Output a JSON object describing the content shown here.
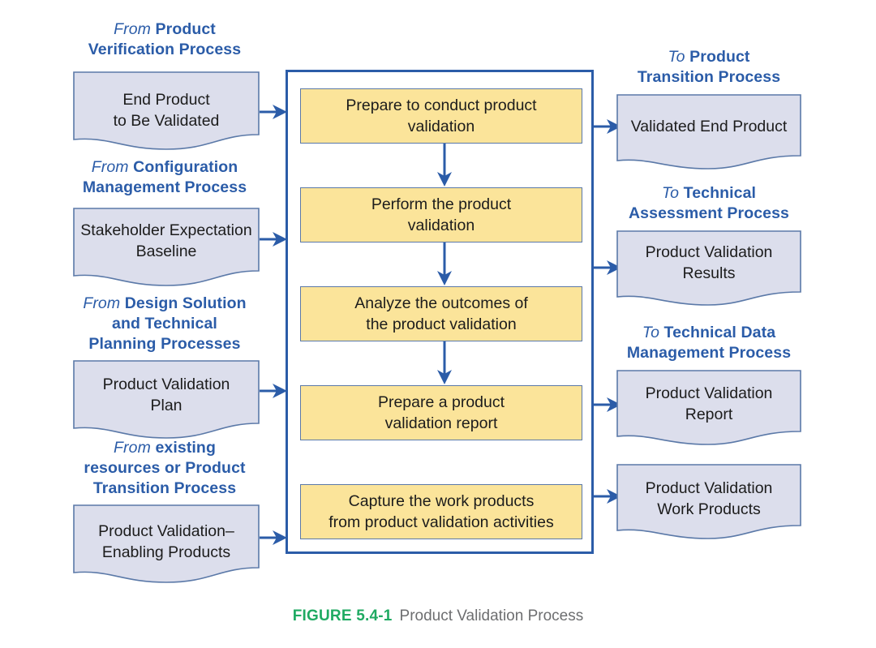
{
  "figure": {
    "number": "FIGURE 5.4-1",
    "title": "Product Validation Process",
    "colors": {
      "accent_blue": "#2b5ca8",
      "activity_fill": "#fbe49a",
      "artifact_fill": "#dcdeec",
      "artifact_stroke": "#5b79a8",
      "caption_green": "#1faa62",
      "caption_gray": "#6d6e70"
    }
  },
  "inputs": [
    {
      "label_prefix": "From",
      "label_rest": "Product\nVerification Process",
      "label_plain": "From Product Verification Process",
      "artifact": "End Product\nto Be Validated"
    },
    {
      "label_prefix": "From",
      "label_rest": "Configuration\nManagement Process",
      "label_plain": "From Configuration Management Process",
      "artifact": "Stakeholder Expectation\nBaseline"
    },
    {
      "label_prefix": "From",
      "label_rest": "Design Solution\nand Technical\nPlanning Processes",
      "label_plain": "From Design Solution and Technical Planning Processes",
      "artifact": "Product Validation\nPlan"
    },
    {
      "label_prefix": "From",
      "label_rest": "existing\nresources or Product\nTransition Process",
      "label_plain": "From existing resources or Product Transition Process",
      "artifact": "Product Validation–\nEnabling Products"
    }
  ],
  "activities": [
    "Prepare to conduct product\nvalidation",
    "Perform the product\nvalidation",
    "Analyze the outcomes of\nthe product validation",
    "Prepare a product\nvalidation report",
    "Capture the work products\nfrom product validation activities"
  ],
  "outputs": [
    {
      "label_prefix": "To",
      "label_rest": "Product\nTransition Process",
      "label_plain": "To Product Transition Process",
      "artifact": "Validated End Product"
    },
    {
      "label_prefix": "To",
      "label_rest": "Technical\nAssessment Process",
      "label_plain": "To Technical Assessment Process",
      "artifact": "Product Validation\nResults"
    },
    {
      "label_prefix": "To",
      "label_rest": "Technical Data\nManagement Process",
      "label_plain": "To Technical Data Management Process",
      "artifact": "Product Validation\nReport"
    },
    {
      "label_prefix": "",
      "label_rest": "",
      "label_plain": "",
      "artifact": "Product Validation\nWork Products"
    }
  ]
}
